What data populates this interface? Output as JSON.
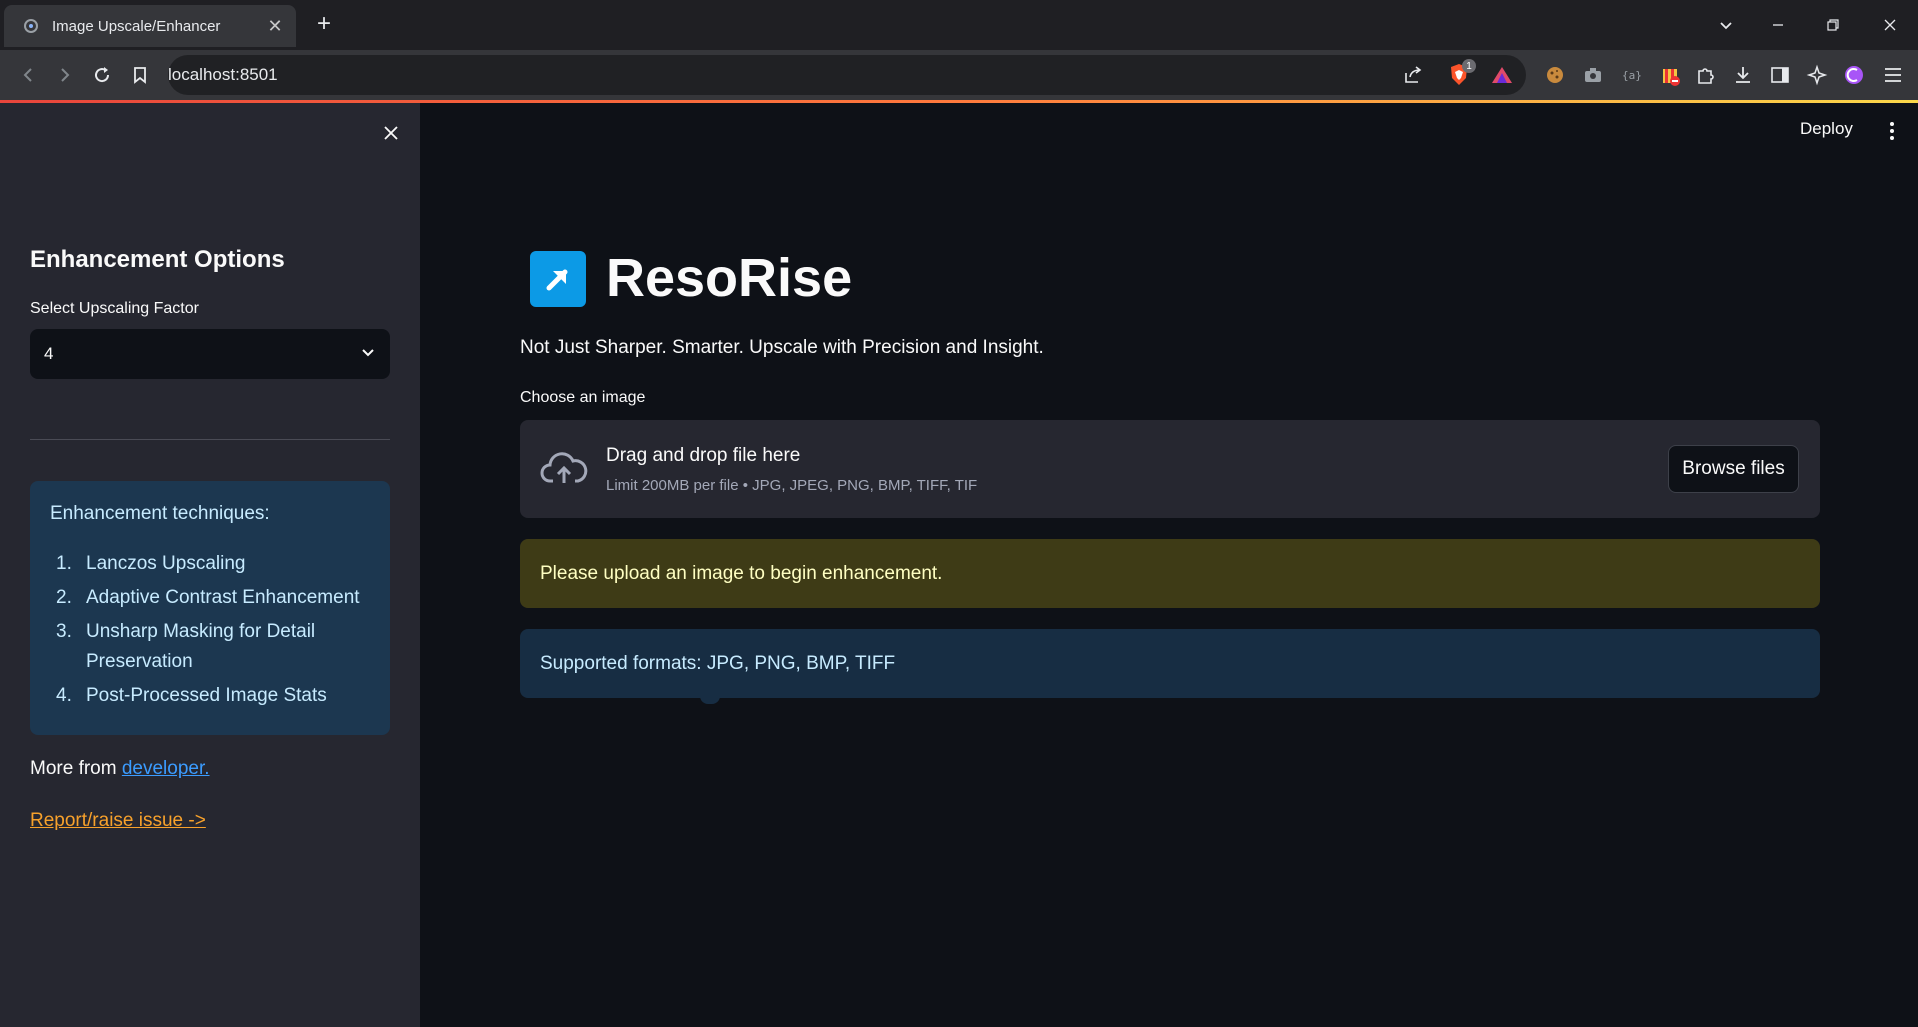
{
  "browser": {
    "tab_title": "Image Upscale/Enhancer",
    "url": "localhost:8501",
    "brave_badge": "1"
  },
  "sidebar": {
    "title": "Enhancement Options",
    "select_label": "Select Upscaling Factor",
    "select_value": "4",
    "info_heading": "Enhancement techniques:",
    "techniques": [
      {
        "num": "1.",
        "text": "Lanczos Upscaling"
      },
      {
        "num": "2.",
        "text": "Adaptive Contrast Enhancement"
      },
      {
        "num": "3.",
        "text": "Unsharp Masking for Detail Preservation"
      },
      {
        "num": "4.",
        "text": "Post-Processed Image Stats"
      }
    ],
    "more_prefix": "More from ",
    "more_link": "developer.",
    "report_link": "Report/raise issue ->"
  },
  "header": {
    "deploy_label": "Deploy"
  },
  "main": {
    "app_title": "ResoRise",
    "subtitle": "Not Just Sharper. Smarter. Upscale with Precision and Insight.",
    "uploader_label": "Choose an image",
    "dropzone_title": "Drag and drop file here",
    "dropzone_limits": "Limit 200MB per file • JPG, JPEG, PNG, BMP, TIFF, TIF",
    "browse_label": "Browse files",
    "warning_text": "Please upload an image to begin enhancement.",
    "info_text": "Supported formats: JPG, PNG, BMP, TIFF"
  },
  "colors": {
    "accent": "#0c9ae6",
    "link": "#3b9cff",
    "report_link": "#f7a12b",
    "warning_bg": "#3e3b16",
    "info_bg": "#172d43"
  }
}
